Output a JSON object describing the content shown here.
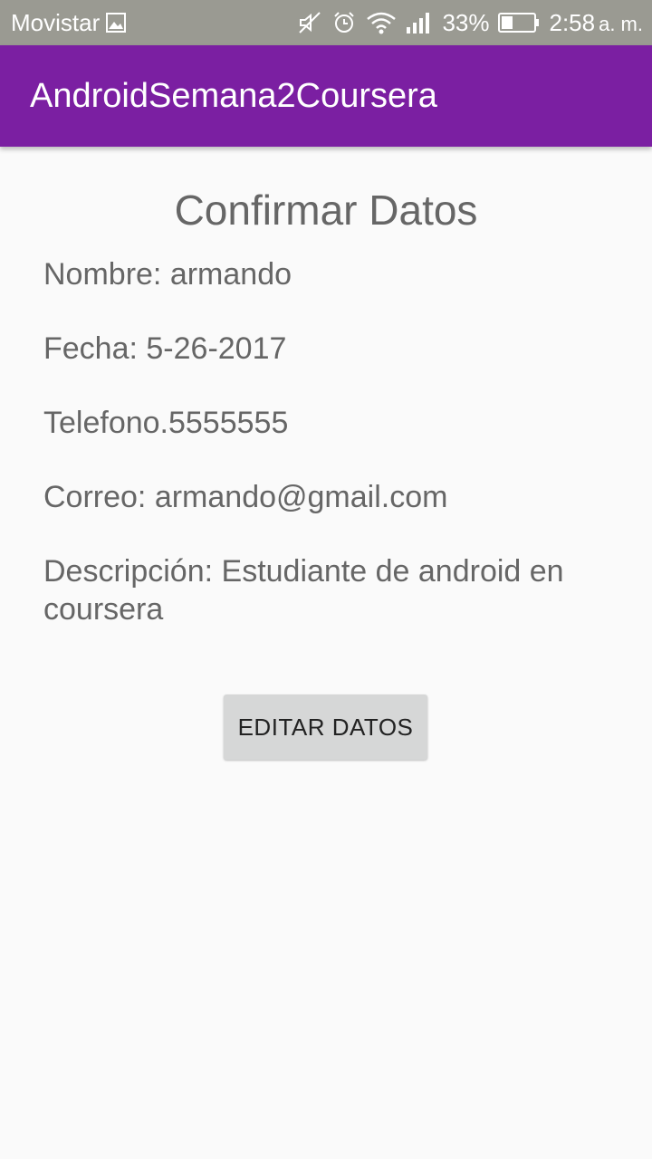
{
  "status_bar": {
    "carrier": "Movistar",
    "battery_percent": "33%",
    "time": "2:58",
    "ampm": "a. m.",
    "icons": [
      "image-icon",
      "muted-icon",
      "alarm-icon",
      "wifi-icon",
      "signal-icon",
      "battery-icon"
    ]
  },
  "app_bar": {
    "title": "AndroidSemana2Coursera",
    "color": "#7b1fa2"
  },
  "main": {
    "title": "Confirmar Datos",
    "fields": [
      "Nombre: armando",
      "Fecha: 5-26-2017",
      "Telefono.5555555",
      "Correo: armando@gmail.com",
      "Descripción: Estudiante de android en coursera"
    ],
    "edit_button_label": "EDITAR DATOS"
  }
}
